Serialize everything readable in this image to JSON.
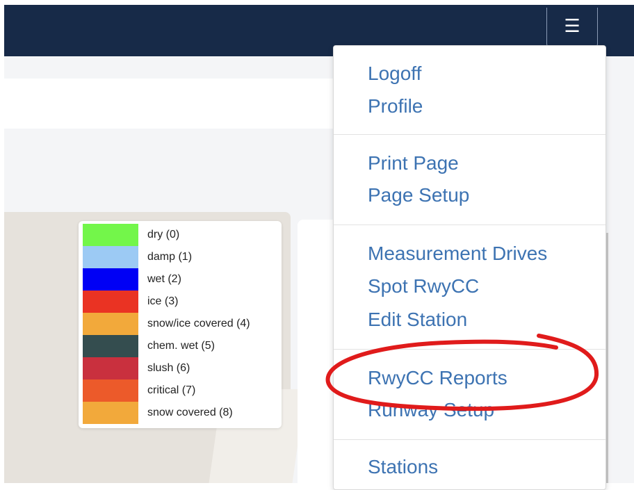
{
  "navbar": {
    "toggle_icon": "hamburger-icon",
    "toggle_glyph": "☰"
  },
  "legend": {
    "items": [
      {
        "label": "dry (0)",
        "color": "#73f64a"
      },
      {
        "label": "damp (1)",
        "color": "#9ccaf4"
      },
      {
        "label": "wet (2)",
        "color": "#0000f5"
      },
      {
        "label": "ice (3)",
        "color": "#ea3323"
      },
      {
        "label": "snow/ice covered (4)",
        "color": "#f2a93b"
      },
      {
        "label": "chem. wet (5)",
        "color": "#344d4f"
      },
      {
        "label": "slush (6)",
        "color": "#c9303e"
      },
      {
        "label": "critical (7)",
        "color": "#ec5a2a"
      },
      {
        "label": "snow covered (8)",
        "color": "#f2a93b"
      }
    ]
  },
  "menu": {
    "logoff": "Logoff",
    "profile": "Profile",
    "print_page": "Print Page",
    "page_setup": "Page Setup",
    "measurement_drives": "Measurement Drives",
    "spot_rwycc": "Spot RwyCC",
    "edit_station": "Edit Station",
    "rwycc_reports": "RwyCC Reports",
    "runway_setup": "Runway Setup",
    "stations": "Stations"
  },
  "colors": {
    "navbar": "#172a48",
    "link": "#3d73b2",
    "annotation": "#e01b1b"
  }
}
